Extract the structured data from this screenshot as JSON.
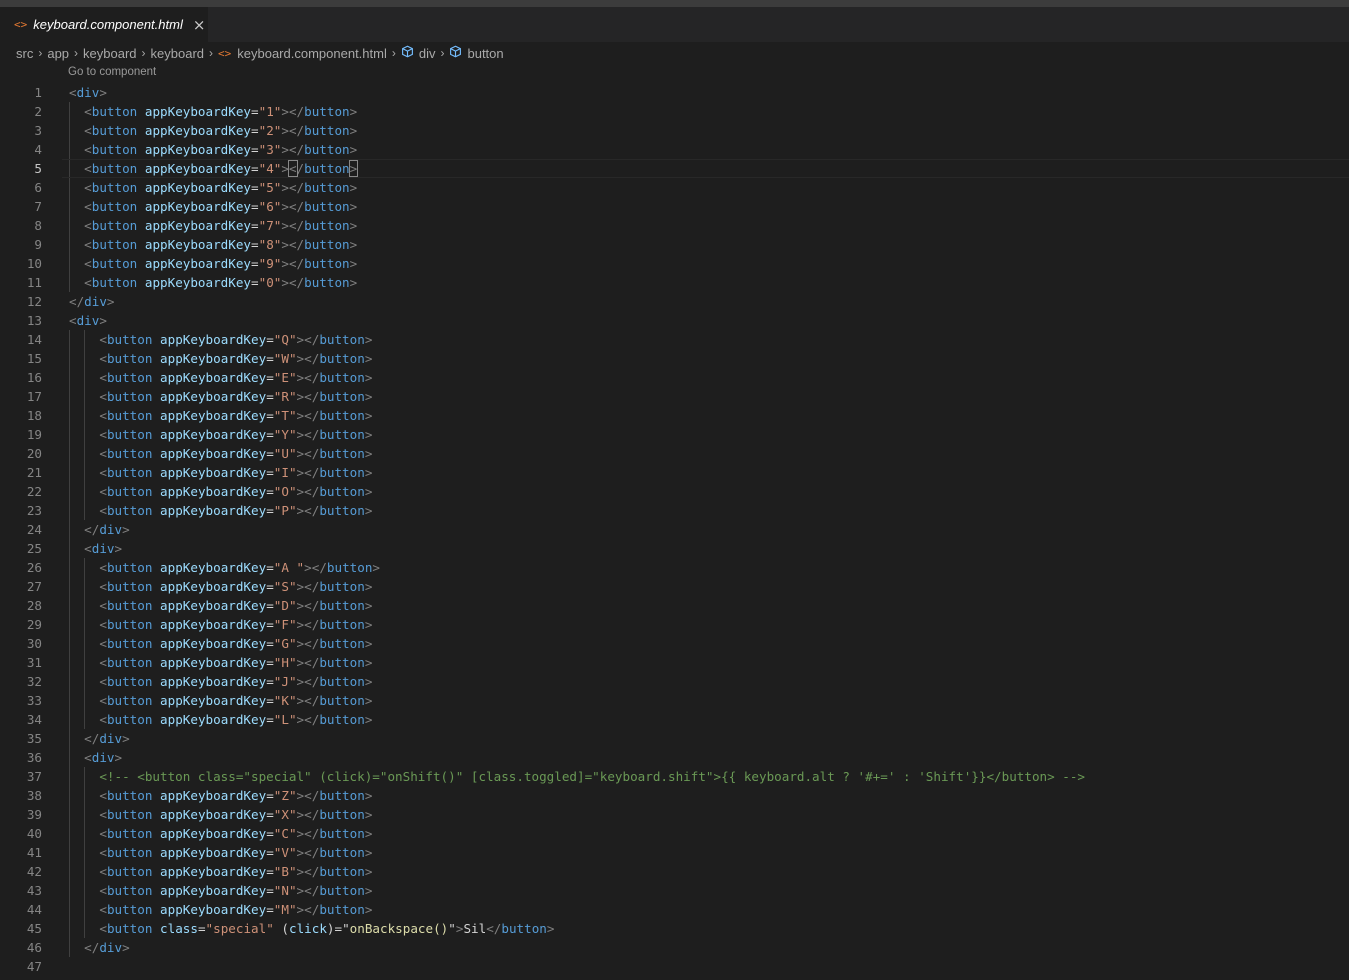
{
  "tab": {
    "label": "keyboard.component.html",
    "icon": "html-file-icon",
    "close": "×"
  },
  "breadcrumb": [
    "src",
    "app",
    "keyboard",
    "keyboard",
    "keyboard.component.html",
    "div",
    "button"
  ],
  "codelens": "Go to component",
  "active_line": 5,
  "lines": [
    {
      "n": "1",
      "i": 0,
      "k": "open",
      "tag": "div"
    },
    {
      "n": "2",
      "i": 1,
      "k": "key",
      "v": "1"
    },
    {
      "n": "3",
      "i": 1,
      "k": "key",
      "v": "2"
    },
    {
      "n": "4",
      "i": 1,
      "k": "key",
      "v": "3"
    },
    {
      "n": "5",
      "i": 1,
      "k": "key",
      "v": "4",
      "bm": true
    },
    {
      "n": "6",
      "i": 1,
      "k": "key",
      "v": "5"
    },
    {
      "n": "7",
      "i": 1,
      "k": "key",
      "v": "6"
    },
    {
      "n": "8",
      "i": 1,
      "k": "key",
      "v": "7"
    },
    {
      "n": "9",
      "i": 1,
      "k": "key",
      "v": "8"
    },
    {
      "n": "10",
      "i": 1,
      "k": "key",
      "v": "9"
    },
    {
      "n": "11",
      "i": 1,
      "k": "key",
      "v": "0"
    },
    {
      "n": "12",
      "i": 0,
      "k": "close",
      "tag": "div"
    },
    {
      "n": "13",
      "i": 0,
      "k": "open",
      "tag": "div"
    },
    {
      "n": "14",
      "i": 2,
      "k": "key",
      "v": "Q"
    },
    {
      "n": "15",
      "i": 2,
      "k": "key",
      "v": "W"
    },
    {
      "n": "16",
      "i": 2,
      "k": "key",
      "v": "E"
    },
    {
      "n": "17",
      "i": 2,
      "k": "key",
      "v": "R"
    },
    {
      "n": "18",
      "i": 2,
      "k": "key",
      "v": "T"
    },
    {
      "n": "19",
      "i": 2,
      "k": "key",
      "v": "Y"
    },
    {
      "n": "20",
      "i": 2,
      "k": "key",
      "v": "U"
    },
    {
      "n": "21",
      "i": 2,
      "k": "key",
      "v": "I"
    },
    {
      "n": "22",
      "i": 2,
      "k": "key",
      "v": "O"
    },
    {
      "n": "23",
      "i": 2,
      "k": "key",
      "v": "P"
    },
    {
      "n": "24",
      "i": 1,
      "k": "close",
      "tag": "div"
    },
    {
      "n": "25",
      "i": 1,
      "k": "open",
      "tag": "div"
    },
    {
      "n": "26",
      "i": 2,
      "k": "key",
      "v": "A "
    },
    {
      "n": "27",
      "i": 2,
      "k": "key",
      "v": "S"
    },
    {
      "n": "28",
      "i": 2,
      "k": "key",
      "v": "D"
    },
    {
      "n": "29",
      "i": 2,
      "k": "key",
      "v": "F"
    },
    {
      "n": "30",
      "i": 2,
      "k": "key",
      "v": "G"
    },
    {
      "n": "31",
      "i": 2,
      "k": "key",
      "v": "H"
    },
    {
      "n": "32",
      "i": 2,
      "k": "key",
      "v": "J"
    },
    {
      "n": "33",
      "i": 2,
      "k": "key",
      "v": "K"
    },
    {
      "n": "34",
      "i": 2,
      "k": "key",
      "v": "L"
    },
    {
      "n": "35",
      "i": 1,
      "k": "close",
      "tag": "div"
    },
    {
      "n": "36",
      "i": 1,
      "k": "open",
      "tag": "div"
    },
    {
      "n": "37",
      "i": 2,
      "k": "comment",
      "text": "<!-- <button class=\"special\" (click)=\"onShift()\" [class.toggled]=\"keyboard.shift\">{{ keyboard.alt ? '#+=' : 'Shift'}}</button> -->"
    },
    {
      "n": "38",
      "i": 2,
      "k": "key",
      "v": "Z"
    },
    {
      "n": "39",
      "i": 2,
      "k": "key",
      "v": "X"
    },
    {
      "n": "40",
      "i": 2,
      "k": "key",
      "v": "C"
    },
    {
      "n": "41",
      "i": 2,
      "k": "key",
      "v": "V"
    },
    {
      "n": "42",
      "i": 2,
      "k": "key",
      "v": "B"
    },
    {
      "n": "43",
      "i": 2,
      "k": "key",
      "v": "N"
    },
    {
      "n": "44",
      "i": 2,
      "k": "key",
      "v": "M"
    },
    {
      "n": "45",
      "i": 2,
      "k": "backspace",
      "cls": "special",
      "handler": "onBackspace()",
      "label": "Sil"
    },
    {
      "n": "46",
      "i": 1,
      "k": "close",
      "tag": "div"
    },
    {
      "n": "47",
      "i": 0,
      "k": "empty"
    }
  ]
}
